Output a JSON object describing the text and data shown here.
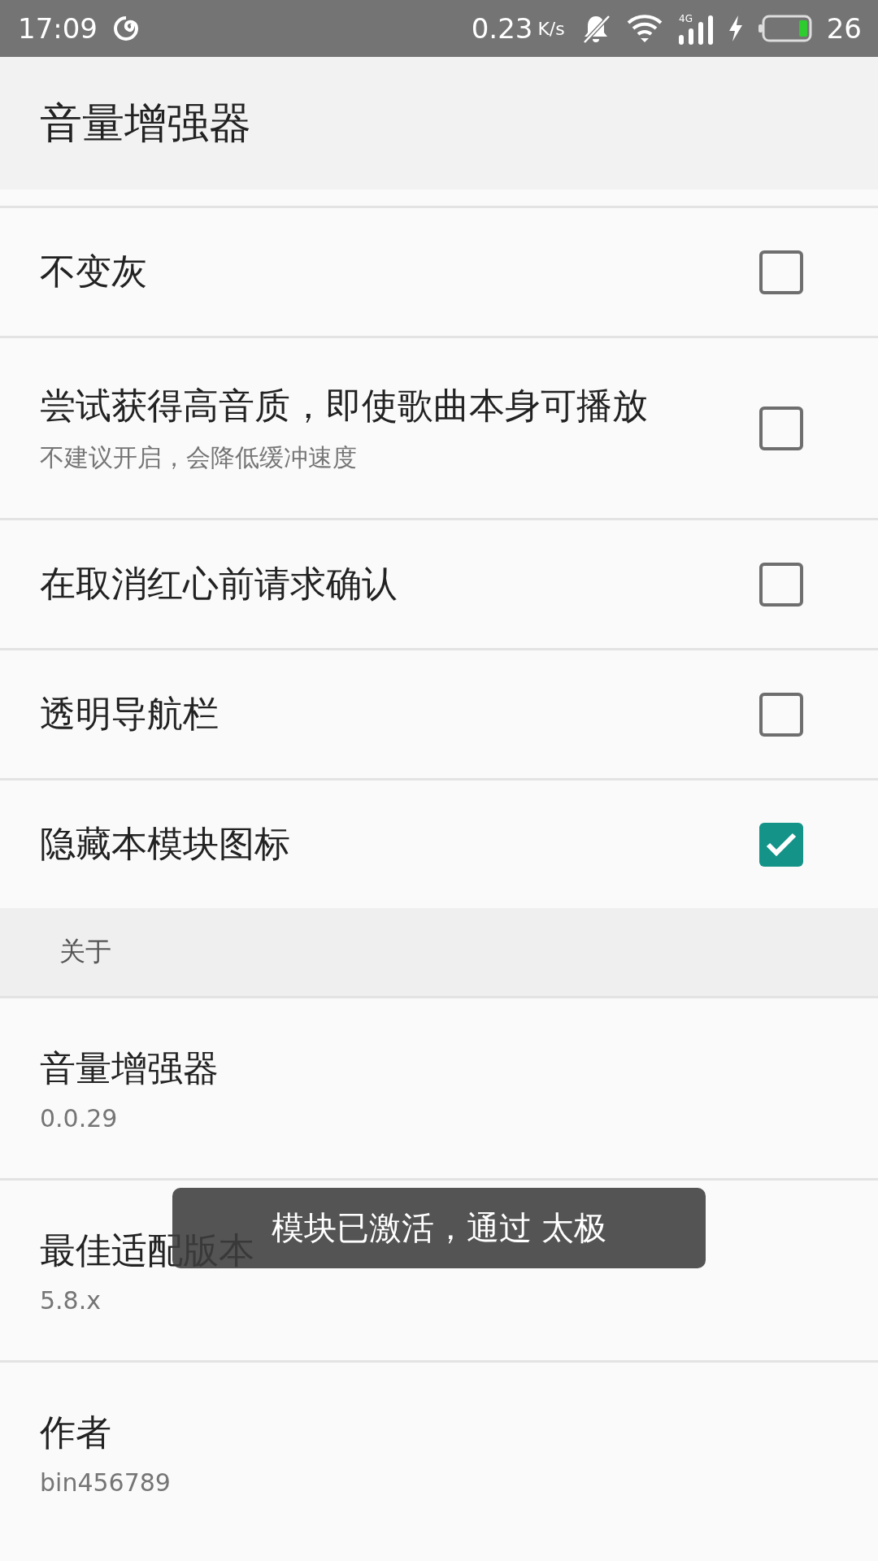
{
  "status_bar": {
    "time": "17:09",
    "speed": "0.23",
    "speed_unit": "K/s",
    "network": "4G",
    "battery": "26"
  },
  "app_bar": {
    "title": "音量增强器"
  },
  "settings": [
    {
      "kind": "checkbox",
      "title": "不变灰",
      "checked": false
    },
    {
      "kind": "checkbox",
      "title": "尝试获得高音质，即使歌曲本身可播放",
      "summary": "不建议开启，会降低缓冲速度",
      "checked": false
    },
    {
      "kind": "checkbox",
      "title": "在取消红心前请求确认",
      "checked": false
    },
    {
      "kind": "checkbox",
      "title": "透明导航栏",
      "checked": false
    },
    {
      "kind": "checkbox",
      "title": "隐藏本模块图标",
      "checked": true
    },
    {
      "kind": "category",
      "title": "关于"
    },
    {
      "kind": "info",
      "title": "音量增强器",
      "summary": "0.0.29"
    },
    {
      "kind": "info",
      "title": "最佳适配版本",
      "summary": "5.8.x"
    },
    {
      "kind": "info",
      "title": "作者",
      "summary": "bin456789"
    }
  ],
  "toast": {
    "text": "模块已激活，通过 太极"
  }
}
